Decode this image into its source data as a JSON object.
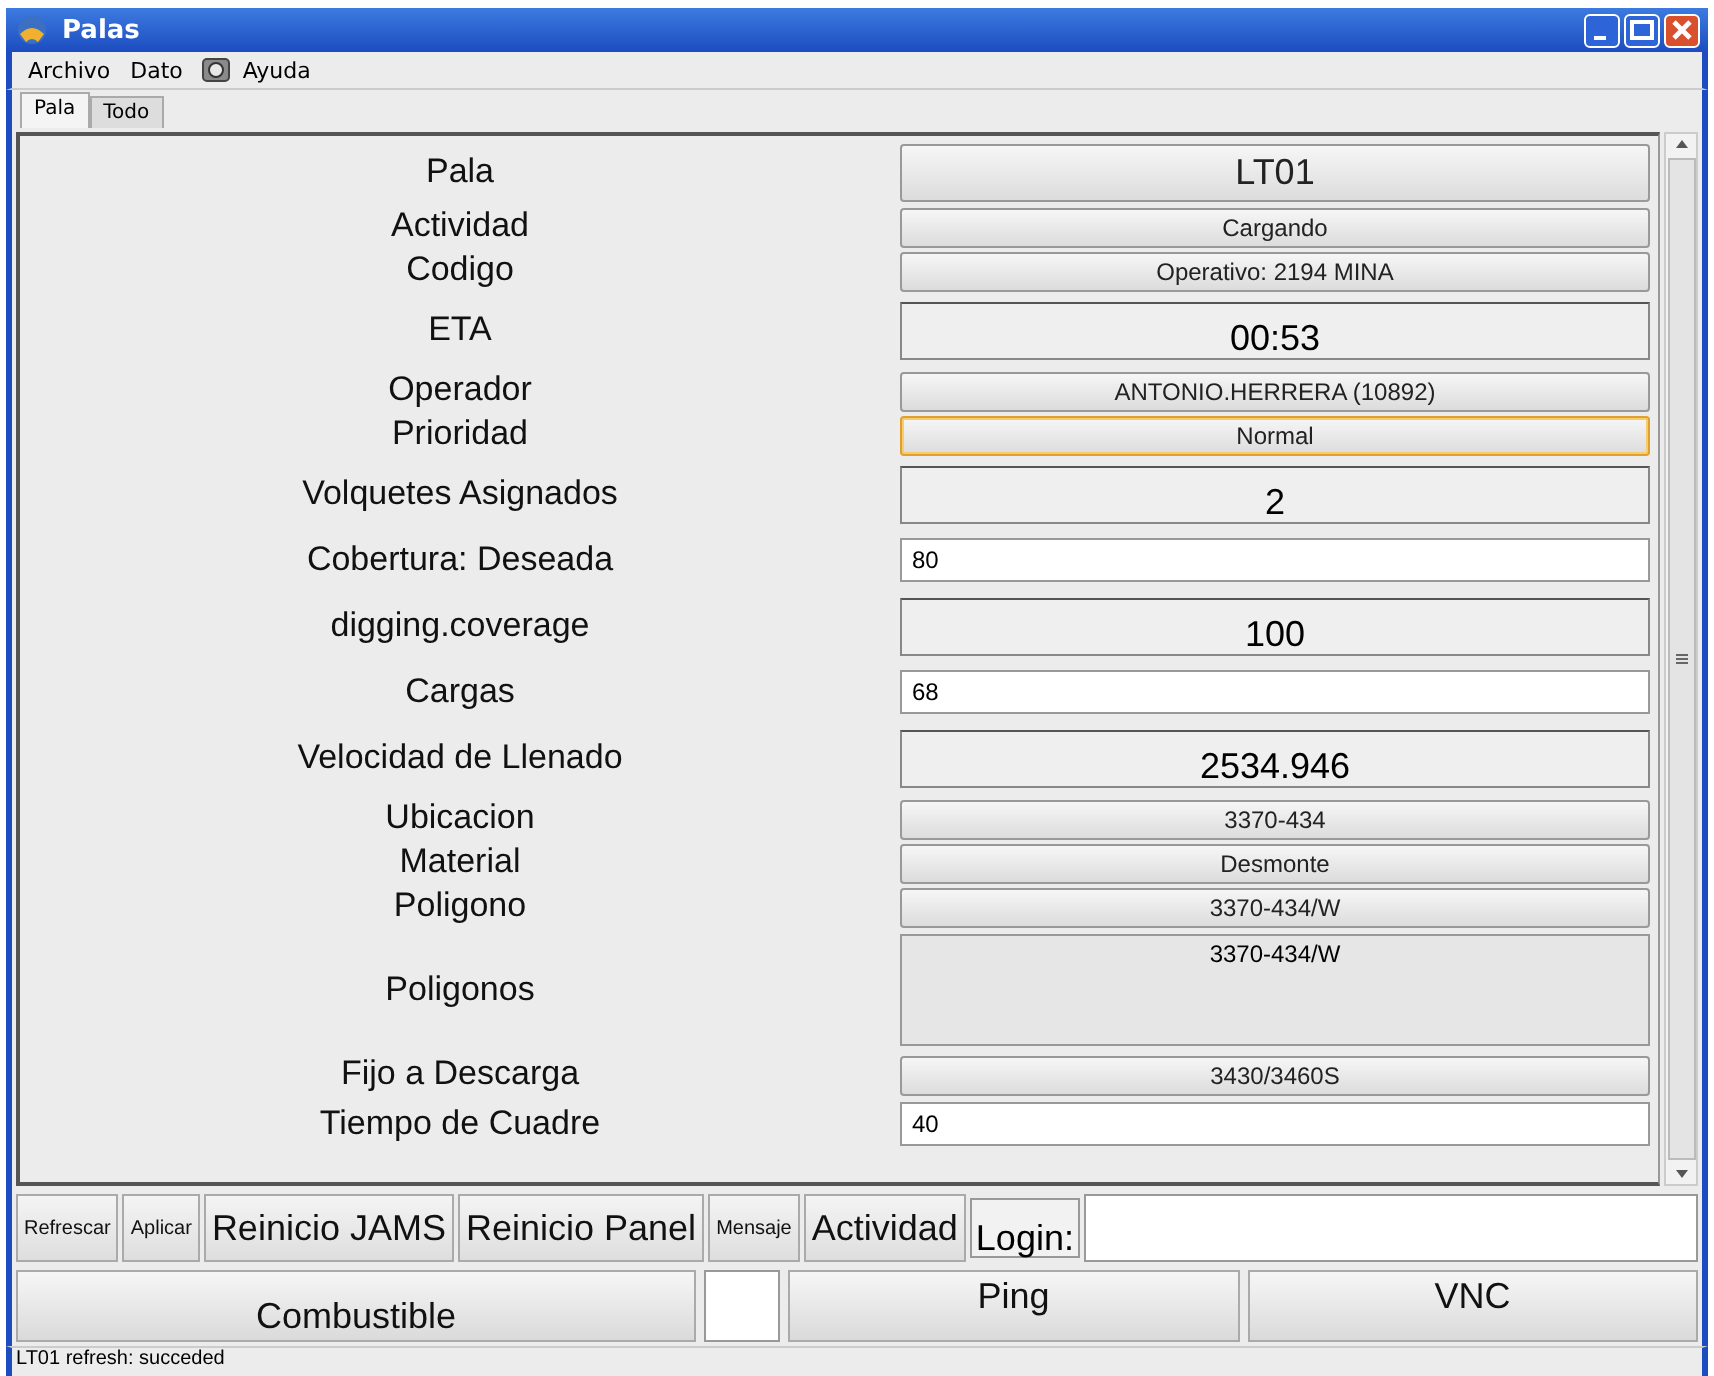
{
  "window": {
    "title": "Palas"
  },
  "menu": [
    "Archivo",
    "Dato",
    "Ayuda"
  ],
  "tabs": [
    {
      "label": "Pala",
      "selected": true
    },
    {
      "label": "Todo",
      "selected": false
    }
  ],
  "rows": [
    {
      "label": "Pala",
      "kind": "button-large",
      "value": "LT01",
      "focused": false
    },
    {
      "label": "Actividad",
      "kind": "button",
      "value": "Cargando",
      "focused": false
    },
    {
      "label": "Codigo",
      "kind": "button",
      "value": "Operativo: 2194 MINA",
      "focused": false
    },
    {
      "label": "ETA",
      "kind": "display",
      "value": "00:53",
      "focused": false
    },
    {
      "label": "Operador",
      "kind": "button",
      "value": "ANTONIO.HERRERA (10892)",
      "focused": false
    },
    {
      "label": "Prioridad",
      "kind": "button",
      "value": "Normal",
      "focused": true
    },
    {
      "label": "Volquetes Asignados",
      "kind": "display",
      "value": "2",
      "focused": false
    },
    {
      "label": "Cobertura: Deseada",
      "kind": "input",
      "value": "80",
      "focused": false
    },
    {
      "label": "digging.coverage",
      "kind": "display",
      "value": "100",
      "focused": false
    },
    {
      "label": "Cargas",
      "kind": "input",
      "value": "68",
      "focused": false
    },
    {
      "label": "Velocidad de Llenado",
      "kind": "display",
      "value": "2534.946",
      "focused": false
    },
    {
      "label": "Ubicacion",
      "kind": "button",
      "value": "3370-434",
      "focused": false
    },
    {
      "label": "Material",
      "kind": "button",
      "value": "Desmonte",
      "focused": false
    },
    {
      "label": "Poligono",
      "kind": "button",
      "value": "3370-434/W",
      "focused": false
    },
    {
      "label": "Poligonos",
      "kind": "list",
      "value": "3370-434/W",
      "focused": false
    },
    {
      "label": "Fijo a Descarga",
      "kind": "button",
      "value": "3430/3460S",
      "focused": false
    },
    {
      "label": "Tiempo de Cuadre",
      "kind": "input",
      "value": "40",
      "focused": false
    }
  ],
  "toolbar": [
    {
      "label": "Refrescar",
      "kind": "small"
    },
    {
      "label": "Aplicar",
      "kind": "small"
    },
    {
      "label": "Reinicio JAMS",
      "kind": "large"
    },
    {
      "label": "Reinicio Panel",
      "kind": "large"
    },
    {
      "label": "Mensaje",
      "kind": "small"
    },
    {
      "label": "Actividad",
      "kind": "large"
    }
  ],
  "login": {
    "label": "Login:"
  },
  "bottom_buttons": [
    "Combustible",
    "Ping",
    "VNC"
  ],
  "status_bar": "LT01 refresh: succeded"
}
